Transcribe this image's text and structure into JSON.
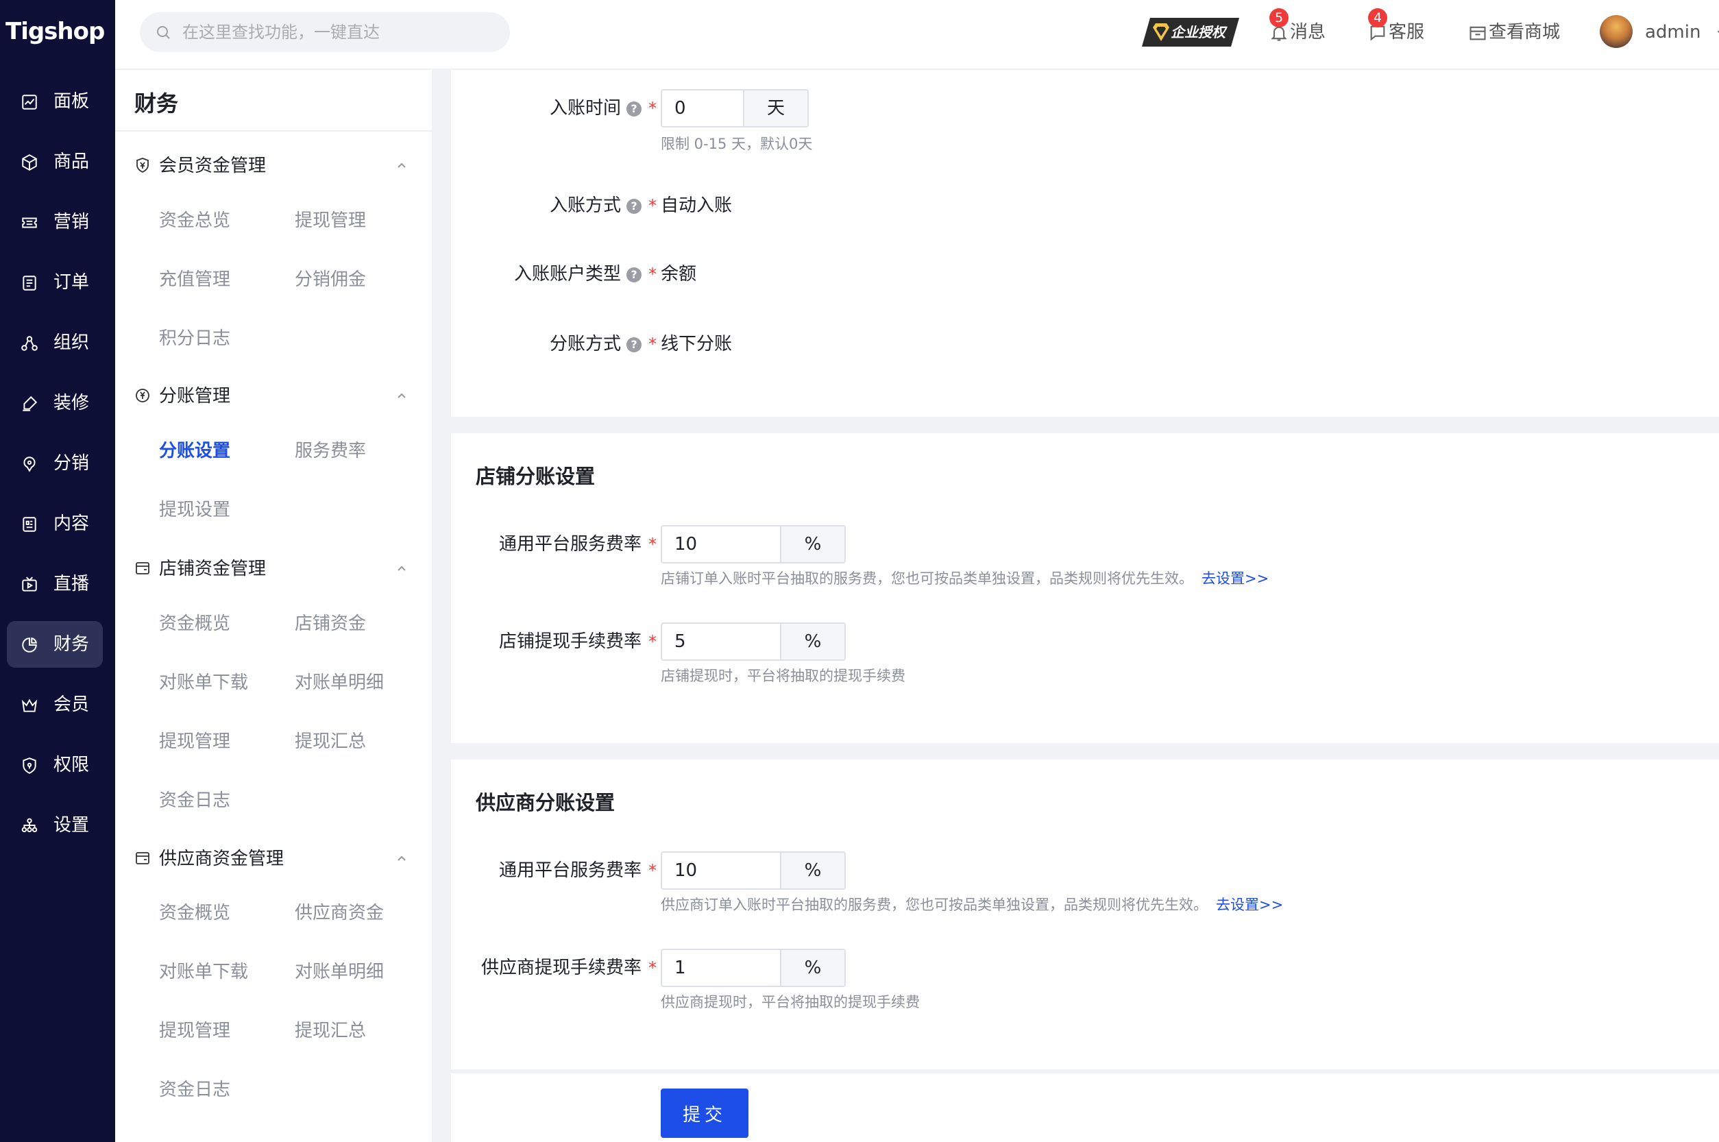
{
  "app": {
    "logo": "Tigshop"
  },
  "nav": [
    {
      "label": "面板",
      "icon": "chart-line-icon"
    },
    {
      "label": "商品",
      "icon": "box-icon"
    },
    {
      "label": "营销",
      "icon": "ticket-icon"
    },
    {
      "label": "订单",
      "icon": "order-list-icon"
    },
    {
      "label": "组织",
      "icon": "org-icon"
    },
    {
      "label": "装修",
      "icon": "brush-icon"
    },
    {
      "label": "分销",
      "icon": "share-icon"
    },
    {
      "label": "内容",
      "icon": "document-icon"
    },
    {
      "label": "直播",
      "icon": "live-tv-icon"
    },
    {
      "label": "财务",
      "icon": "pie-chart-icon",
      "active": true
    },
    {
      "label": "会员",
      "icon": "crown-icon"
    },
    {
      "label": "权限",
      "icon": "shield-icon"
    },
    {
      "label": "设置",
      "icon": "settings-icon"
    }
  ],
  "header": {
    "search_placeholder": "在这里查找功能，一键直达",
    "enterprise_badge": "企业授权",
    "messages": {
      "label": "消息",
      "count": "5"
    },
    "service": {
      "label": "客服",
      "count": "4"
    },
    "store": {
      "label": "查看商城"
    },
    "user": {
      "name": "admin"
    }
  },
  "submenu": {
    "title": "财务",
    "groups": [
      {
        "label": "会员资金管理",
        "items": [
          "资金总览",
          "提现管理",
          "充值管理",
          "分销佣金",
          "积分日志"
        ]
      },
      {
        "label": "分账管理",
        "items": [
          "分账设置",
          "服务费率",
          "提现设置"
        ]
      },
      {
        "label": "店铺资金管理",
        "items": [
          "资金概览",
          "店铺资金",
          "对账单下载",
          "对账单明细",
          "提现管理",
          "提现汇总",
          "资金日志"
        ]
      },
      {
        "label": "供应商资金管理",
        "items": [
          "资金概览",
          "供应商资金",
          "对账单下载",
          "对账单明细",
          "提现管理",
          "提现汇总",
          "资金日志"
        ]
      }
    ],
    "active_item": "分账设置"
  },
  "settlement": {
    "time": {
      "label": "入账时间",
      "value": "0",
      "unit": "天",
      "hint": "限制 0-15 天，默认0天"
    },
    "method": {
      "label": "入账方式",
      "value": "自动入账"
    },
    "account_type": {
      "label": "入账账户类型",
      "value": "余额"
    },
    "split_method": {
      "label": "分账方式",
      "value": "线下分账"
    }
  },
  "shop": {
    "title": "店铺分账设置",
    "service_rate": {
      "label": "通用平台服务费率",
      "value": "10",
      "unit": "%",
      "hint": "店铺订单入账时平台抽取的服务费，您也可按品类单独设置，品类规则将优先生效。",
      "link": "去设置>>"
    },
    "withdraw_fee": {
      "label": "店铺提现手续费率",
      "value": "5",
      "unit": "%",
      "hint": "店铺提现时，平台将抽取的提现手续费"
    }
  },
  "supplier": {
    "title": "供应商分账设置",
    "service_rate": {
      "label": "通用平台服务费率",
      "value": "10",
      "unit": "%",
      "hint": "供应商订单入账时平台抽取的服务费，您也可按品类单独设置，品类规则将优先生效。",
      "link": "去设置>>"
    },
    "withdraw_fee": {
      "label": "供应商提现手续费率",
      "value": "1",
      "unit": "%",
      "hint": "供应商提现时，平台将抽取的提现手续费"
    }
  },
  "actions": {
    "submit": "提交"
  },
  "colors": {
    "rail_bg": "#0d0f36",
    "primary": "#1d4ee8",
    "required": "#f03a3a",
    "badge": "#f03a3a"
  }
}
